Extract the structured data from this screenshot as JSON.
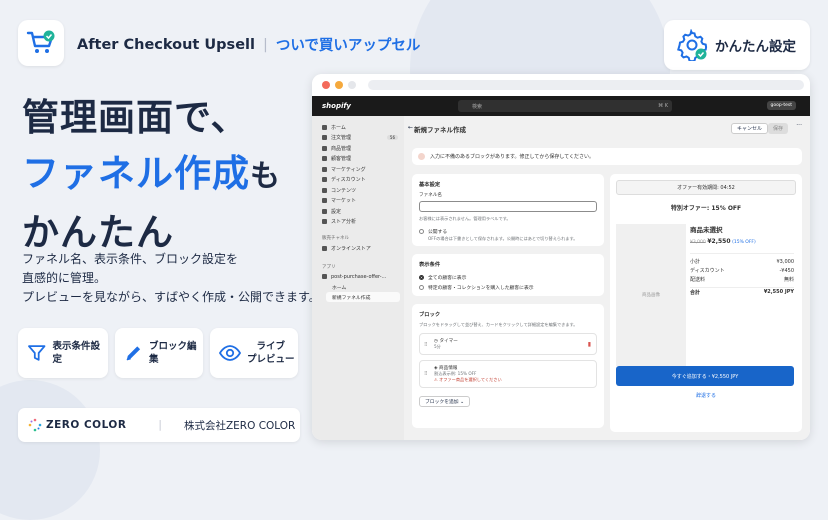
{
  "header": {
    "app_name": "After Checkout Upsell",
    "separator": "|",
    "tagline": "ついで買いアップセル",
    "badge_label": "かんたん設定"
  },
  "headline": {
    "line1": "管理画面で、",
    "line2_accent": "ファネル作成",
    "line2_suffix": "も",
    "line3": "かんたん"
  },
  "description": {
    "line1": "ファネル名、表示条件、ブロック設定を",
    "line2": "直感的に管理。",
    "line3": "プレビューを見ながら、すばやく作成・公開できます。"
  },
  "features": [
    {
      "label": "表示条件設定",
      "icon": "filter-icon"
    },
    {
      "label": "ブロック編集",
      "icon": "pencil-icon"
    },
    {
      "label_line1": "ライブ",
      "label_line2": "プレビュー",
      "icon": "eye-icon"
    }
  ],
  "company": {
    "brand": "ZERO COLOR",
    "divider": "|",
    "name": "株式会社ZERO COLOR"
  },
  "shopify": {
    "logo": "shopify",
    "search_placeholder": "検索",
    "search_shortcut": "⌘ K",
    "user": "goop-test",
    "sidebar": [
      {
        "label": "ホーム"
      },
      {
        "label": "注文管理",
        "count": "56"
      },
      {
        "label": "商品管理"
      },
      {
        "label": "顧客管理"
      },
      {
        "label": "マーケティング"
      },
      {
        "label": "ディスカウント"
      },
      {
        "label": "コンテンツ"
      },
      {
        "label": "マーケット"
      },
      {
        "label": "設定"
      },
      {
        "label": "ストア分析"
      }
    ],
    "sales_channel_heading": "販売チャネル",
    "online_store": "オンラインストア",
    "apps_heading": "アプリ",
    "app_name": "post-purchase-offer-...",
    "app_sub_home": "ホーム",
    "app_sub_new": "新規ファネル作成",
    "page_title": "新規ファネル作成",
    "cancel": "キャンセル",
    "save": "保存",
    "banner": "入力に不備のあるブロックがあります。修正してから保存してください。",
    "basic": {
      "heading": "基本設定",
      "funnel_label": "ファネル名",
      "funnel_help": "お客様には表示されません。管理用ラベルです。",
      "publish": "公開する",
      "publish_help": "OFFの場合は下書きとして保存されます。公開時にはあとで切り替えられます。"
    },
    "conditions": {
      "heading": "表示条件",
      "opt1": "全ての顧客に表示",
      "opt2": "特定の顧客・コレクションを購入した顧客に表示"
    },
    "blocks": {
      "heading": "ブロック",
      "help": "ブロックをドラッグして並び替え、カードをクリックして詳細設定を編集できます。",
      "timer_title": "タイマー",
      "timer_value": "5分",
      "product_title": "商品情報",
      "product_discount": "割込表示例: 15% OFF",
      "product_error": "オファー商品を選択してください",
      "add_block": "ブロックを追加"
    },
    "preview": {
      "offer_timer": "オファー有効期間: 04:52",
      "special_offer": "特別オファー: 15% OFF",
      "image_placeholder": "商品画像",
      "product_name": "商品未選択",
      "old_price": "¥3,000",
      "new_price": "¥2,550",
      "discount": "(15% OFF)",
      "subtotal_label": "小計",
      "subtotal_value": "¥3,000",
      "discount_label": "ディスカウント",
      "discount_value": "-¥450",
      "shipping_label": "配送料",
      "shipping_value": "無料",
      "total_label": "合計",
      "total_value": "¥2,550 JPY",
      "add_button": "今すぐ追加する・¥2,550 JPY",
      "decline": "辞退する"
    }
  },
  "colors": {
    "accent": "#1f6fe5",
    "navy": "#1d2a44",
    "background": "#eef1f6",
    "green_check": "#1fb39a"
  }
}
